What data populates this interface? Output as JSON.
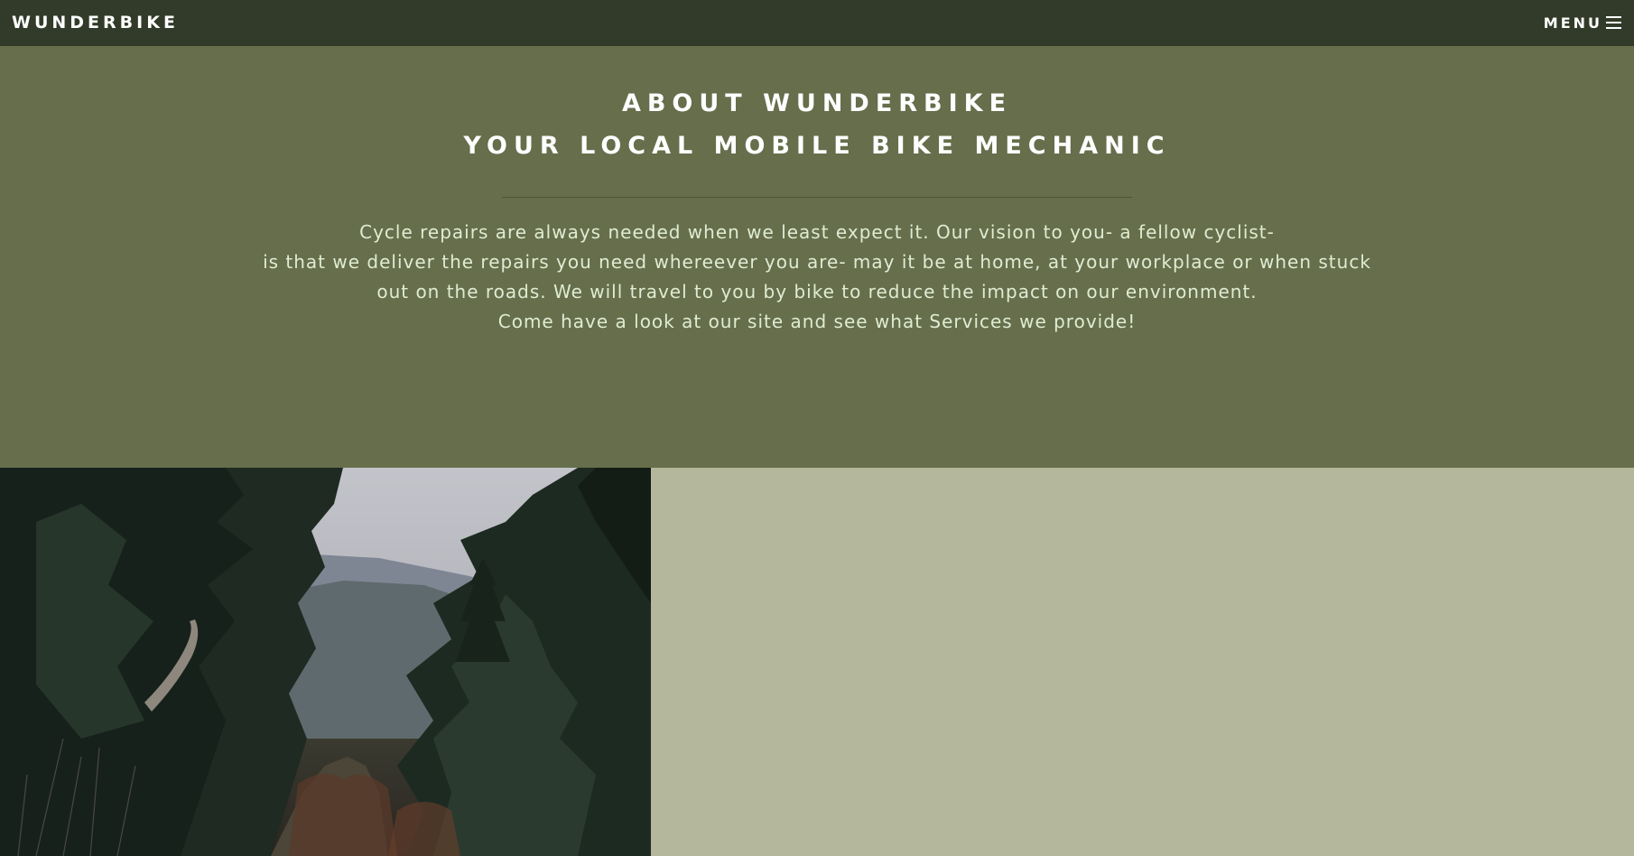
{
  "nav": {
    "brand": "WUNDERBIKE",
    "menu_label": "MENU",
    "menu_icon": "hamburger-icon"
  },
  "about": {
    "title_line1": "ABOUT WUNDERBIKE",
    "title_line2": "YOUR LOCAL MOBILE BIKE MECHANIC",
    "paragraph_lines": [
      "Cycle repairs are always needed when we least expect it. Our vision to you- a fellow cyclist-",
      "is that we deliver the repairs you need whereever you are- may it be at home, at your workplace or when stuck",
      "out on the roads. We will travel to you by bike to reduce the impact on our environment.",
      "Come have a look at our site and see what Services we provide!"
    ]
  },
  "colors": {
    "navbar": "#323b29",
    "about_background": "#666e4b",
    "side_panel": "#b4b79b",
    "heading_text": "#ffffff",
    "body_text": "#dfecd3"
  },
  "photo": {
    "subject": "forest-trail-photo"
  }
}
